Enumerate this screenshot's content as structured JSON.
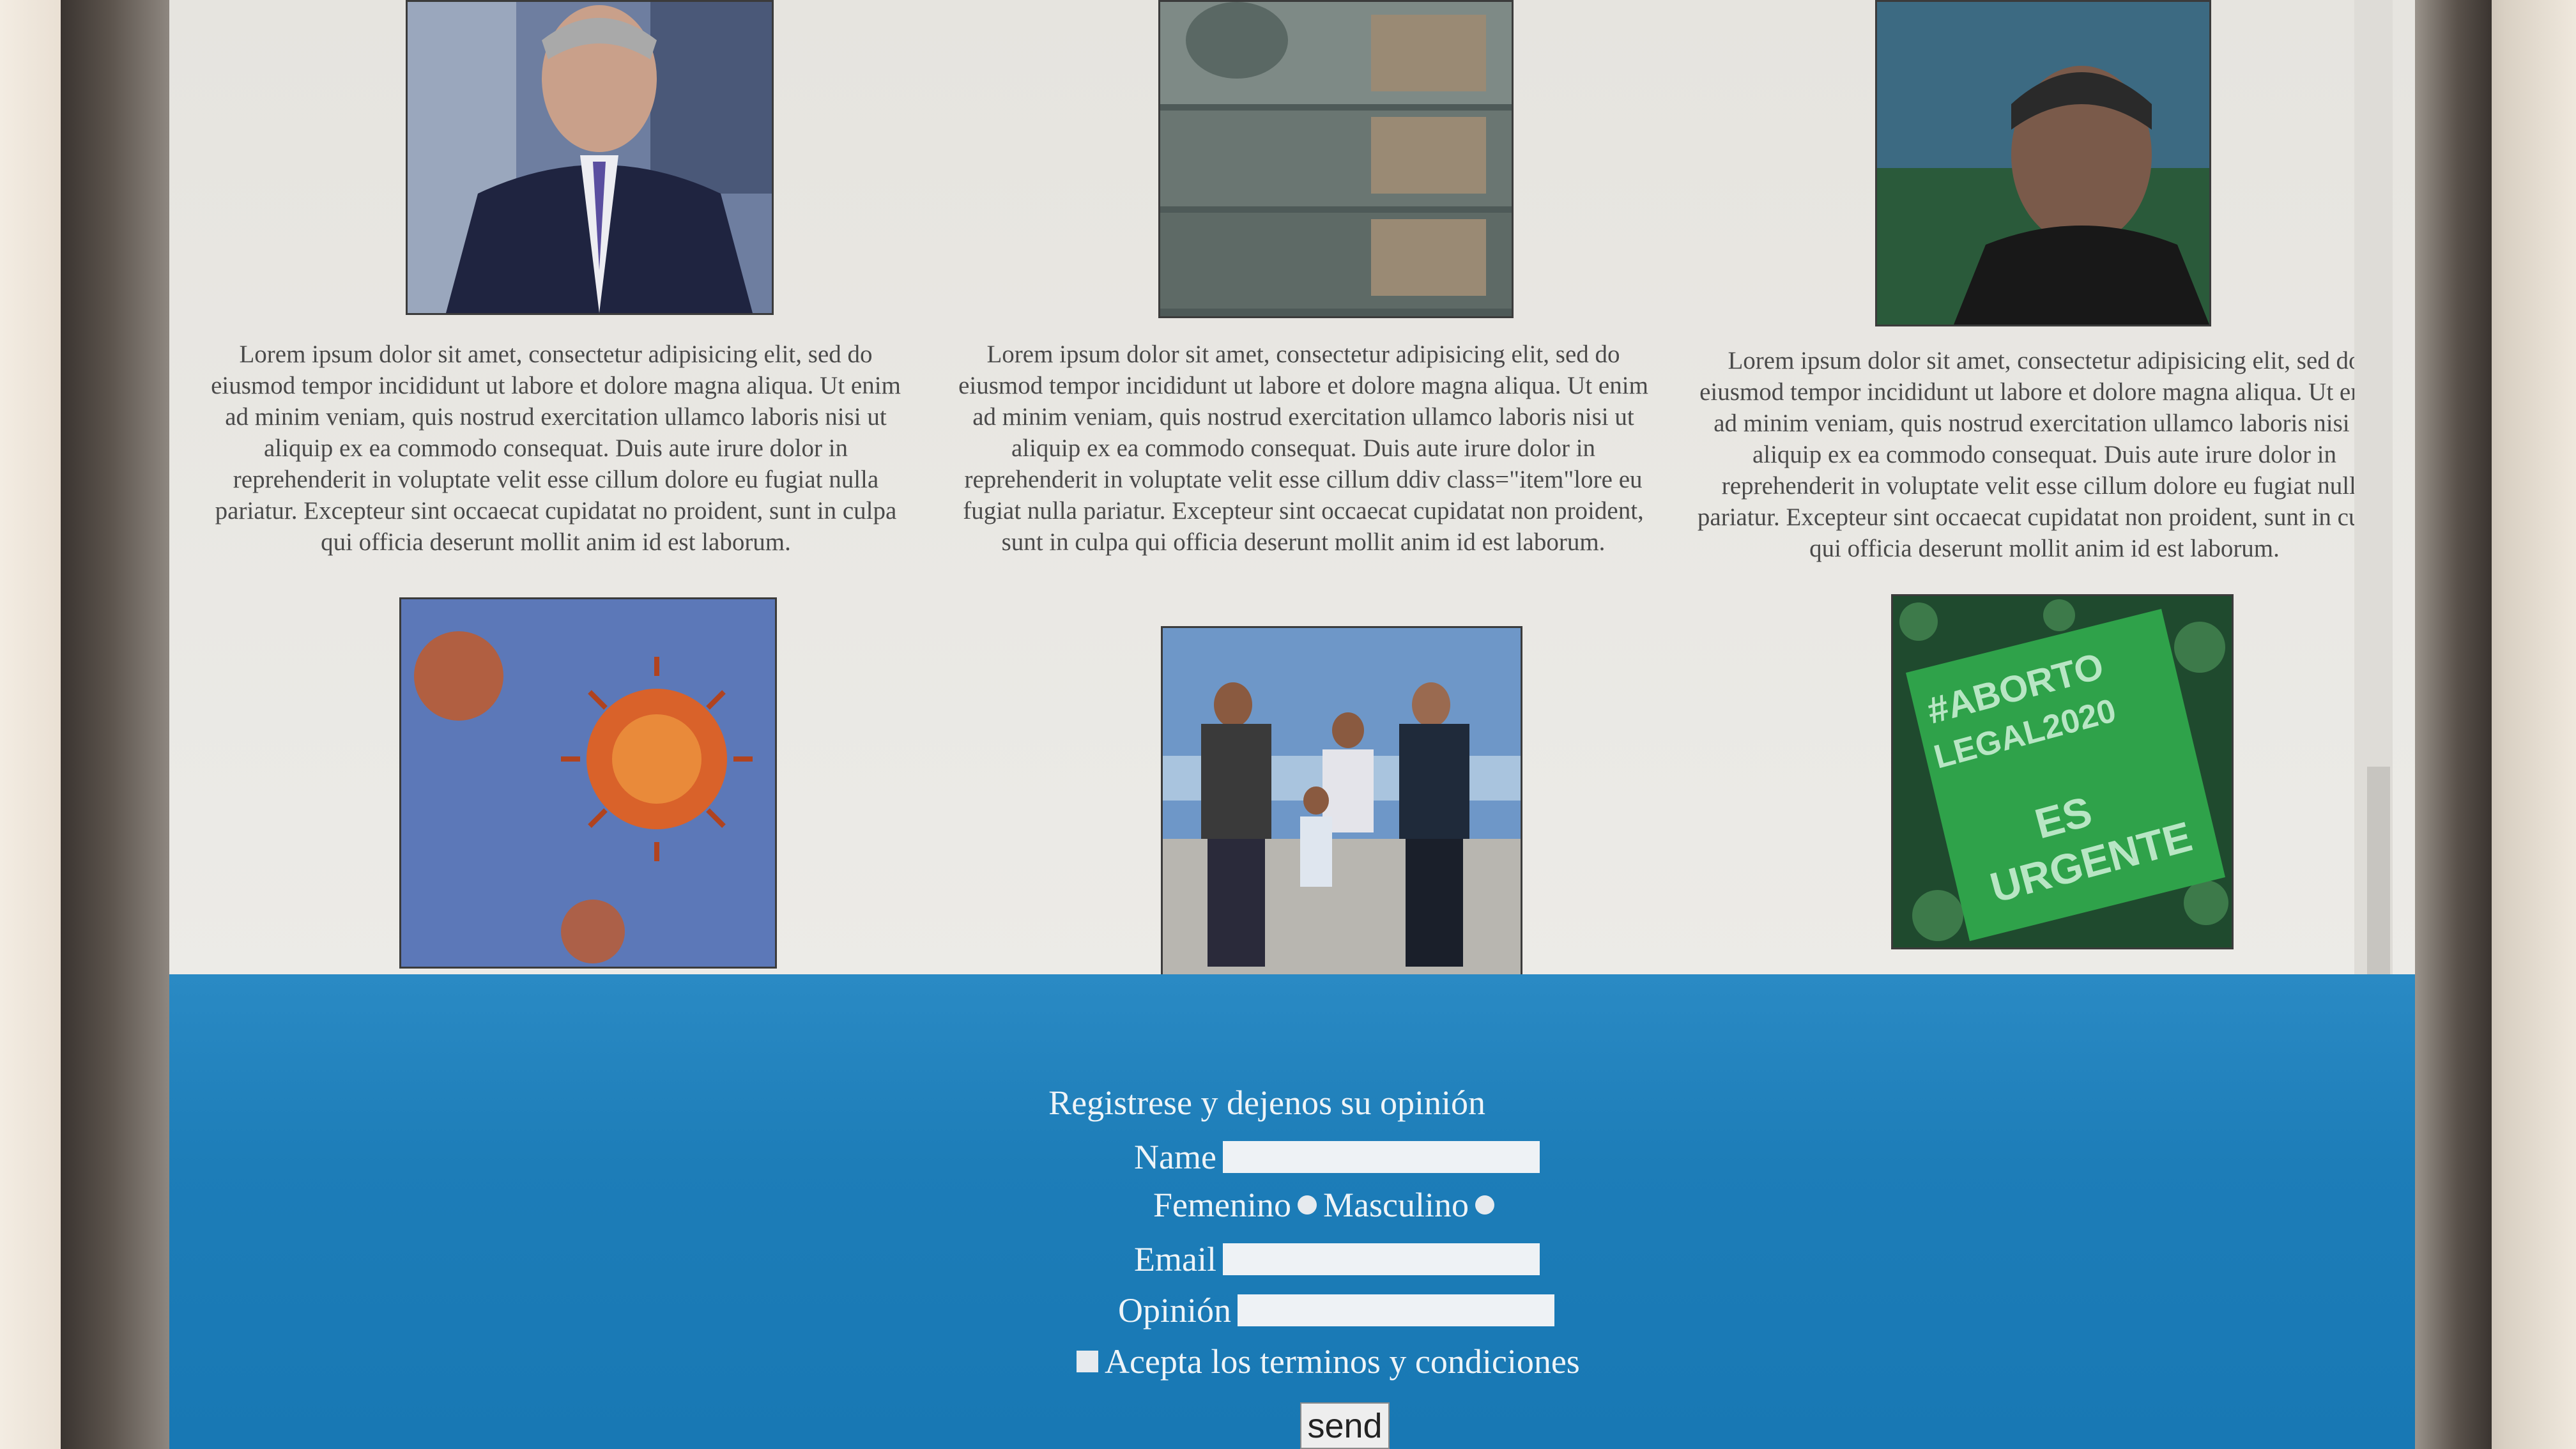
{
  "articles": [
    {
      "text": "Lorem ipsum dolor sit amet, consectetur adipisicing elit, sed do eiusmod tempor incididunt ut labore et dolore magna aliqua. Ut enim ad minim veniam, quis nostrud exercitation ullamco laboris nisi ut aliquip ex ea commodo consequat. Duis aute irure dolor in reprehenderit in voluptate velit esse cillum dolore eu fugiat nulla pariatur. Excepteur sint occaecat cupidatat no proident, sunt in culpa qui officia deserunt mollit anim id est laborum."
    },
    {
      "text": "Lorem ipsum dolor sit amet, consectetur adipisicing elit, sed do eiusmod tempor incididunt ut labore et dolore magna aliqua. Ut enim ad minim veniam, quis nostrud exercitation ullamco laboris nisi ut aliquip ex ea commodo consequat. Duis aute irure dolor in reprehenderit in voluptate velit esse cillum ddiv class=\"item\"lore eu fugiat nulla pariatur. Excepteur sint occaecat cupidatat non proident, sunt in culpa qui officia deserunt mollit anim id est laborum."
    },
    {
      "text": "Lorem ipsum dolor sit amet, consectetur adipisicing elit, sed do eiusmod tempor incididunt ut labore et dolore magna aliqua. Ut enim ad minim veniam, quis nostrud exercitation ullamco laboris nisi ut aliquip ex ea commodo consequat. Duis aute irure dolor in reprehenderit in voluptate velit esse cillum dolore eu fugiat nulla pariatur. Excepteur sint occaecat cupidatat non proident, sunt in culpa qui officia deserunt mollit anim id est laborum."
    }
  ],
  "poster": {
    "hashtag_line1": "#ABORTO",
    "hashtag_line2": "LEGAL2020",
    "slogan_line1": "ES",
    "slogan_line2": "URGENTE"
  },
  "form": {
    "title": "Registrese y dejenos su opinión",
    "name_label": "Name",
    "name_value": "",
    "gender_female_label": "Femenino",
    "gender_male_label": "Masculino",
    "email_label": "Email",
    "email_value": "",
    "opinion_label": "Opinión",
    "opinion_value": "",
    "terms_label": "Acepta los terminos y condiciones",
    "send_label": "send"
  },
  "colors": {
    "footer_blue": "#1d7db8",
    "page_bg": "#e8e6e2",
    "poster_green": "#2fa24a"
  }
}
